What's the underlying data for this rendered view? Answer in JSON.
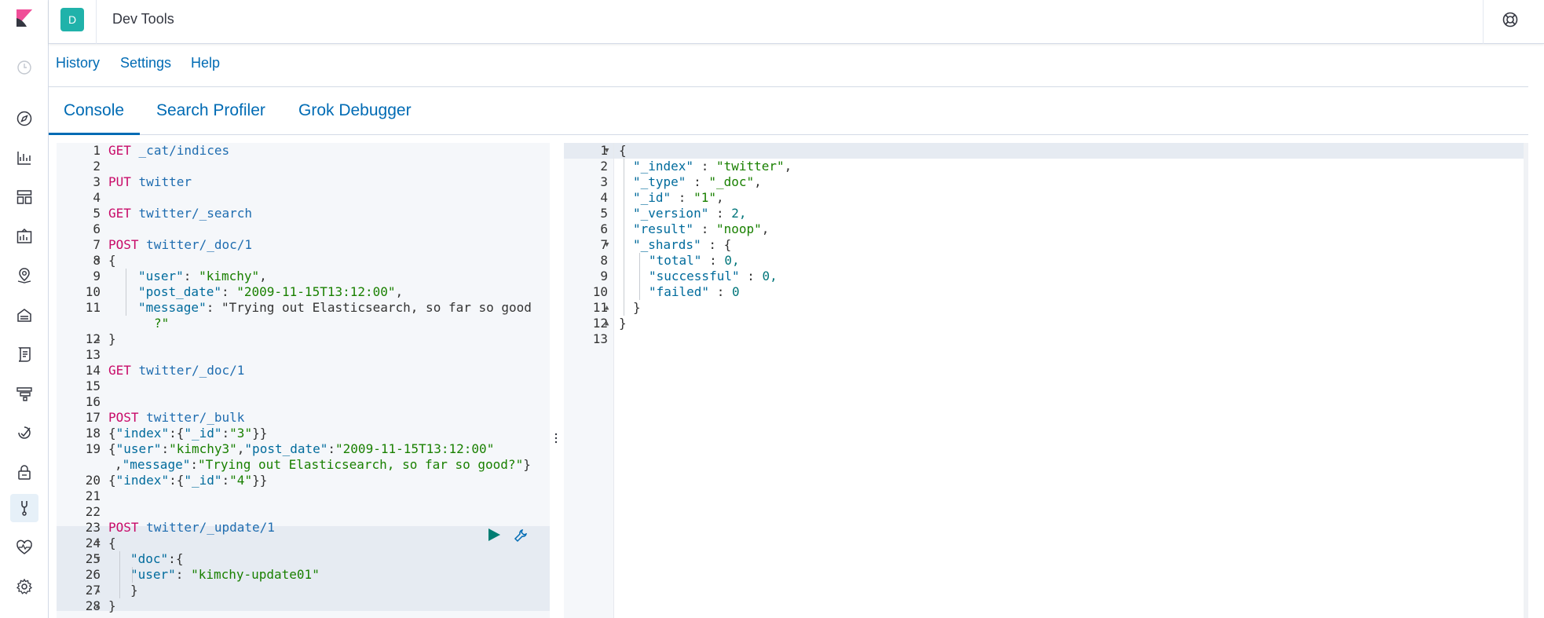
{
  "header": {
    "avatar_letter": "D",
    "title": "Dev Tools"
  },
  "links": {
    "history": "History",
    "settings": "Settings",
    "help": "Help"
  },
  "tabs": [
    {
      "label": "Console",
      "active": true
    },
    {
      "label": "Search Profiler",
      "active": false
    },
    {
      "label": "Grok Debugger",
      "active": false
    }
  ],
  "nav_icons": [
    "recently-viewed-icon",
    "discover-icon",
    "visualize-icon",
    "dashboard-icon",
    "canvas-icon",
    "maps-icon",
    "infrastructure-icon",
    "logs-icon",
    "apm-icon",
    "uptime-icon",
    "siem-icon",
    "dev-tools-icon",
    "monitoring-icon",
    "management-icon"
  ],
  "request_lines": {
    "1": "GET _cat/indices",
    "2": "",
    "3": "PUT twitter",
    "4": "",
    "5": "GET twitter/_search",
    "6": "",
    "7": "POST twitter/_doc/1",
    "8": "{",
    "9": "\"user\": \"kimchy\",",
    "10": "\"post_date\": \"2009-11-15T13:12:00\",",
    "11a": "\"message\": \"Trying out Elasticsearch, so far so good",
    "11b": "?\"",
    "12": "}",
    "13": "",
    "14": "GET twitter/_doc/1",
    "15": "",
    "16": "",
    "17": "POST twitter/_bulk",
    "18": "{\"index\":{\"_id\":\"3\"}}",
    "19a": "{\"user\":\"kimchy3\",\"post_date\":\"2009-11-15T13:12:00\"",
    "19b": ",\"message\":\"Trying out Elasticsearch, so far so good?\"}",
    "20": "{\"index\":{\"_id\":\"4\"}}",
    "21": "",
    "22": "",
    "23": "POST twitter/_update/1",
    "24": "{",
    "25": "\"doc\":{",
    "26": "\"user\": \"kimchy-update01\"",
    "27": "}",
    "28": "}"
  },
  "response_lines": {
    "1": "{",
    "2": "\"_index\" : \"twitter\",",
    "3": "\"_type\" : \"_doc\",",
    "4": "\"_id\" : \"1\",",
    "5": "\"_version\" : 2,",
    "6": "\"result\" : \"noop\",",
    "7": "\"_shards\" : {",
    "8": "\"total\" : 0,",
    "9": "\"successful\" : 0,",
    "10": "\"failed\" : 0",
    "11": "}",
    "12": "}",
    "13": ""
  },
  "actions": {
    "run": "play-icon",
    "settings": "wrench-icon"
  }
}
